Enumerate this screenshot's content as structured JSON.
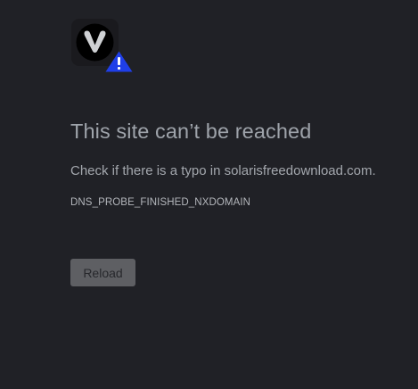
{
  "error": {
    "title": "This site can’t be reached",
    "message": "Check if there is a typo in solarisfreedownload.com.",
    "code": "DNS_PROBE_FINISHED_NXDOMAIN",
    "reload_label": "Reload"
  },
  "icons": {
    "browser_logo": "vivaldi-logo-icon",
    "warning_badge": "warning-triangle-icon"
  },
  "colors": {
    "background": "#202126",
    "warning_badge": "#1f3fe8",
    "title_text": "#9ea3aa",
    "button_bg": "#5e5f63"
  }
}
